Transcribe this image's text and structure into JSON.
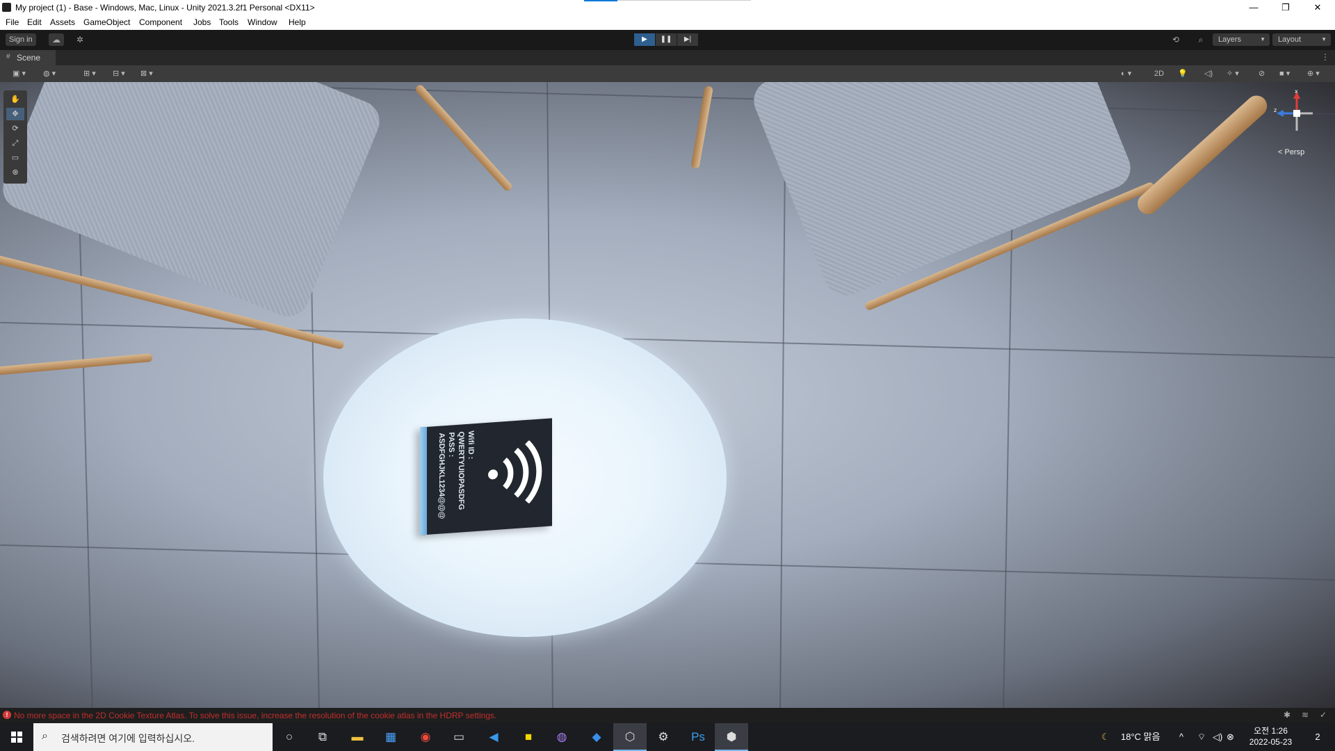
{
  "window": {
    "title": "My project (1) - Base - Windows, Mac, Linux - Unity 2021.3.2f1 Personal <DX11>",
    "minimize": "—",
    "maximize": "❐",
    "close": "✕"
  },
  "menu": [
    "File",
    "Edit",
    "Assets",
    "GameObject",
    "Component",
    "Jobs",
    "Tools",
    "Window",
    "Help"
  ],
  "toolbar": {
    "sign_in": "Sign in",
    "play": "▶",
    "pause": "❚❚",
    "step": "▶|",
    "layers": "Layers",
    "layout": "Layout"
  },
  "scene_tab": {
    "label": "Scene"
  },
  "scene_toolbar": {
    "mode_2d": "2D"
  },
  "viewport": {
    "persp_label": "< Persp",
    "gizmo_axes": {
      "x": "x",
      "z": "z"
    },
    "card_text": [
      "Wifi ID : QWERTYUIOPASDFG",
      "PASS : ASDFGHJKL1234@@@"
    ]
  },
  "status": {
    "error_icon": "!",
    "message": "No more space in the 2D Cookie Texture Atlas. To solve this issue, increase the resolution of the cookie atlas in the HDRP settings."
  },
  "taskbar": {
    "search_placeholder": "검색하려면 여기에 입력하십시오.",
    "weather": "18°C  맑음",
    "time": "오전 1:26",
    "date": "2022-05-23",
    "notification_count": "2"
  },
  "colors": {
    "accent_blue": "#2e5f8f",
    "error_red": "#c22e2e",
    "spot_light": "#eef6fd"
  }
}
